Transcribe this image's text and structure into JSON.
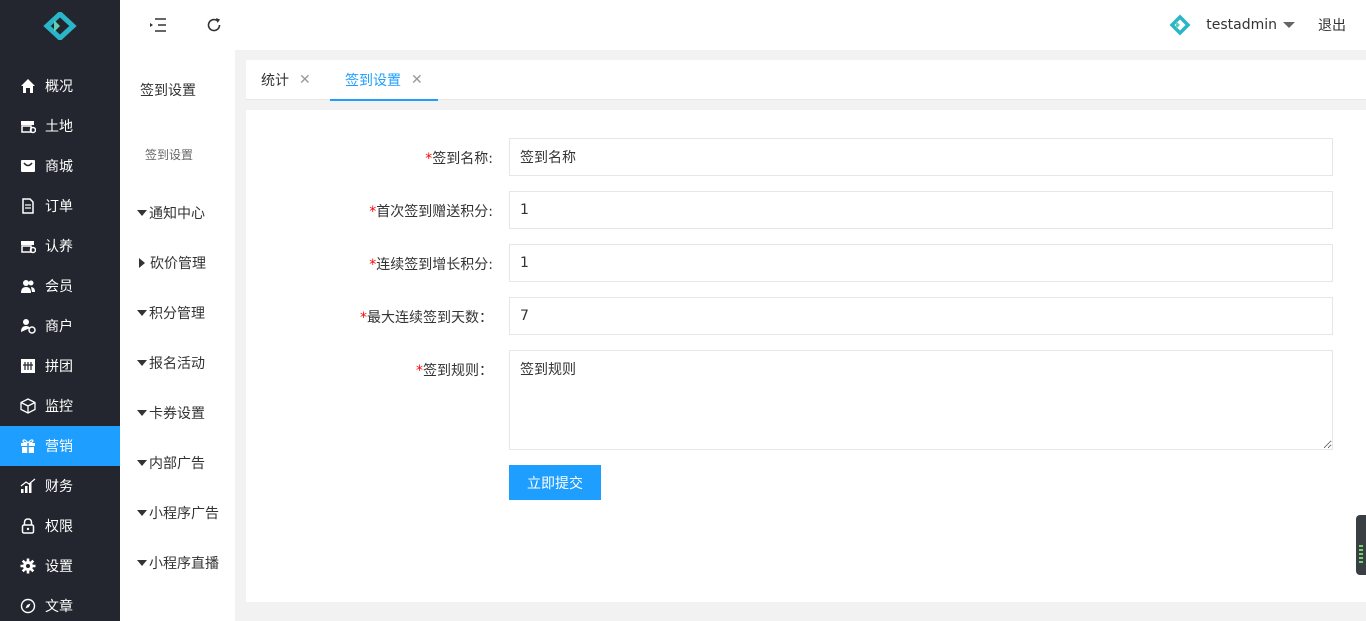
{
  "sidebar": {
    "items": [
      {
        "label": "概况",
        "icon": "home-icon"
      },
      {
        "label": "土地",
        "icon": "store-icon"
      },
      {
        "label": "商城",
        "icon": "mall-icon"
      },
      {
        "label": "订单",
        "icon": "document-icon"
      },
      {
        "label": "认养",
        "icon": "store-icon"
      },
      {
        "label": "会员",
        "icon": "users-icon"
      },
      {
        "label": "商户",
        "icon": "merchant-icon"
      },
      {
        "label": "拼团",
        "icon": "group-icon"
      },
      {
        "label": "监控",
        "icon": "cube-icon"
      },
      {
        "label": "营销",
        "icon": "gift-icon",
        "active": true
      },
      {
        "label": "财务",
        "icon": "chart-icon"
      },
      {
        "label": "权限",
        "icon": "lock-icon"
      },
      {
        "label": "设置",
        "icon": "gear-icon"
      },
      {
        "label": "文章",
        "icon": "compass-icon"
      }
    ]
  },
  "header": {
    "username": "testadmin",
    "logout": "退出"
  },
  "subnav": {
    "title": "签到设置",
    "sub_item": "签到设置",
    "groups": [
      {
        "label": "通知中心",
        "expanded": true
      },
      {
        "label": "砍价管理",
        "expanded": false
      },
      {
        "label": "积分管理",
        "expanded": true
      },
      {
        "label": "报名活动",
        "expanded": true
      },
      {
        "label": "卡券设置",
        "expanded": true
      },
      {
        "label": "内部广告",
        "expanded": true
      },
      {
        "label": "小程序广告",
        "expanded": true
      },
      {
        "label": "小程序直播",
        "expanded": true
      }
    ]
  },
  "tabs": [
    {
      "label": "统计",
      "close": "✕"
    },
    {
      "label": "签到设置",
      "close": "✕",
      "active": true
    }
  ],
  "form": {
    "required_mark": "*",
    "fields": [
      {
        "label": "签到名称:",
        "value": "签到名称"
      },
      {
        "label": "首次签到赠送积分:",
        "value": "1"
      },
      {
        "label": "连续签到增长积分:",
        "value": "1"
      },
      {
        "label": "最大连续签到天数：",
        "value": "7"
      },
      {
        "label": "签到规则：",
        "value": "签到规则"
      }
    ],
    "submit_label": "立即提交"
  },
  "colors": {
    "accent": "#1e9fff",
    "sidebar_bg": "#23262e",
    "required": "#ff0000"
  }
}
